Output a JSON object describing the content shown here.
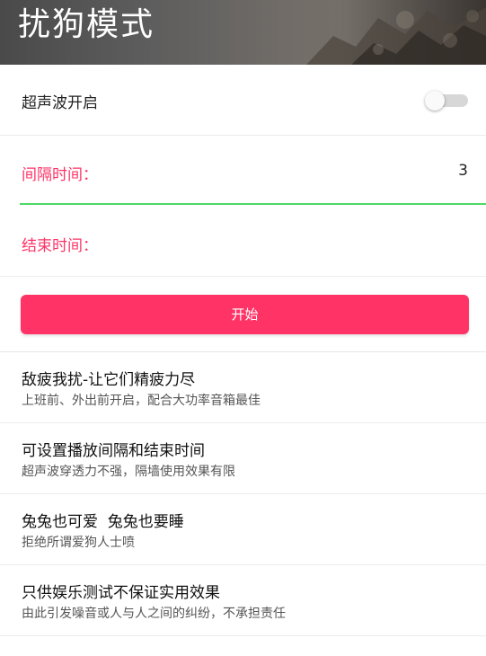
{
  "header": {
    "title": "扰狗模式"
  },
  "settings": {
    "ultrasonic_label": "超声波开启",
    "ultrasonic_on": false,
    "interval_label": "间隔时间：",
    "interval_value": "3",
    "end_time_label": "结束时间：",
    "end_time_value": ""
  },
  "colors": {
    "accent": "#ff3366",
    "focus_underline": "#4cd964"
  },
  "start_button": {
    "label": "开始"
  },
  "info_items": [
    {
      "title": "敌疲我扰-让它们精疲力尽",
      "subtitle": "上班前、外出前开启，配合大功率音箱最佳"
    },
    {
      "title": "可设置播放间隔和结束时间",
      "subtitle": "超声波穿透力不强，隔墙使用效果有限"
    },
    {
      "title": "兔兔也可爱  兔兔也要睡",
      "subtitle": "拒绝所谓爱狗人士喷"
    },
    {
      "title": "只供娱乐测试不保证实用效果",
      "subtitle": "由此引发噪音或人与人之间的纠纷，不承担责任"
    }
  ]
}
